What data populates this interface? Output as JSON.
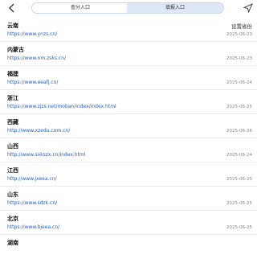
{
  "tabs": [
    {
      "label": "查分入口"
    },
    {
      "label": "填报入口"
    }
  ],
  "settings_label": "设置省份",
  "rows": [
    {
      "province": "云南",
      "url": "https://www.ynzs.cn/",
      "date": "2025-06-23"
    },
    {
      "province": "内蒙古",
      "url": "https://www.nm.zsks.cn/",
      "date": "2025-06-23"
    },
    {
      "province": "福建",
      "url": "https://www.eeafj.cn/",
      "date": "2025-06-24"
    },
    {
      "province": "浙江",
      "url": "https://www.zjzs.net/moban/index/index.html",
      "date": "2025-06-25"
    },
    {
      "province": "西藏",
      "url": "http://www.xzedu.com.cn/",
      "date": "2025-06-26"
    },
    {
      "province": "山西",
      "url": "http://www.sxkszx.cn/index.html",
      "date": "2025-06-24"
    },
    {
      "province": "江西",
      "url": "http://www.jxeea.cn/",
      "date": "2025-06-25"
    },
    {
      "province": "山东",
      "url": "https://www.sdzk.cn/",
      "date": "2025-06-25"
    },
    {
      "province": "北京",
      "url": "https://www.bjeea.cn/",
      "date": "2025-06-25"
    },
    {
      "province": "湖南",
      "url": "",
      "date": ""
    }
  ],
  "icons": {
    "back": "chevron-left-icon",
    "location": "location-arrow-icon"
  }
}
